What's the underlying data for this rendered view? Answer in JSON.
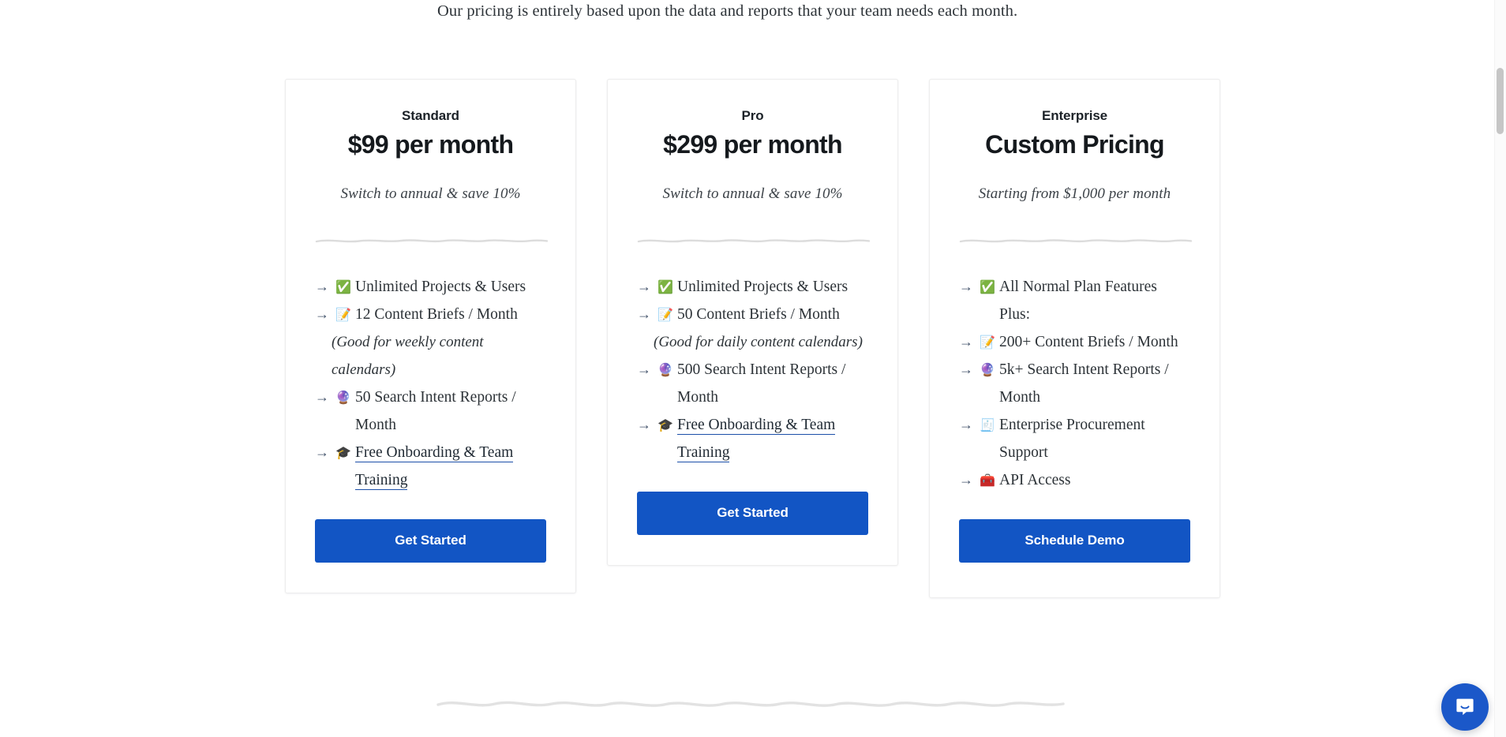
{
  "intro": {
    "paragraph": "Our pricing is entirely based upon the data and reports that your team needs each month."
  },
  "colors": {
    "cta_blue": "#1255c4",
    "link_underline": "#1b4fa8",
    "arrow": "#43536b",
    "divider": "#dcdcdc",
    "intercom_blue": "#1b58c9"
  },
  "plans": [
    {
      "name": "Standard",
      "price": "$99 per month",
      "note": "Switch to annual & save 10%",
      "features": [
        {
          "icon": "white-check-mark-icon",
          "emoji": "✅",
          "text": "Unlimited Projects & Users",
          "link": false
        },
        {
          "icon": "memo-icon",
          "emoji": "📝",
          "text": "12 Content Briefs / Month",
          "link": false
        },
        {
          "icon": "none",
          "emoji": "",
          "text": "(Good for weekly content calendars)",
          "sub": true
        },
        {
          "icon": "crystal-ball-icon",
          "emoji": "🔮",
          "text": "50 Search Intent Reports / Month",
          "link": false
        },
        {
          "icon": "graduation-cap-icon",
          "emoji": "🎓",
          "text": "Free Onboarding & Team Training",
          "link": true
        }
      ],
      "cta": "Get Started"
    },
    {
      "name": "Pro",
      "price": "$299 per month",
      "note": "Switch to annual & save 10%",
      "features": [
        {
          "icon": "white-check-mark-icon",
          "emoji": "✅",
          "text": "Unlimited Projects & Users",
          "link": false
        },
        {
          "icon": "memo-icon",
          "emoji": "📝",
          "text": "50 Content Briefs / Month",
          "link": false
        },
        {
          "icon": "none",
          "emoji": "",
          "text": "(Good for daily content calendars)",
          "sub": true
        },
        {
          "icon": "crystal-ball-icon",
          "emoji": "🔮",
          "text": "500 Search Intent Reports / Month",
          "link": false
        },
        {
          "icon": "graduation-cap-icon",
          "emoji": "🎓",
          "text": "Free Onboarding & Team Training",
          "link": true
        }
      ],
      "cta": "Get Started"
    },
    {
      "name": "Enterprise",
      "price": "Custom Pricing",
      "note": "Starting from $1,000 per month",
      "features": [
        {
          "icon": "white-check-mark-icon",
          "emoji": "✅",
          "text": "All Normal Plan Features Plus:",
          "link": false
        },
        {
          "icon": "memo-icon",
          "emoji": "📝",
          "text": "200+ Content Briefs / Month",
          "link": false
        },
        {
          "icon": "crystal-ball-icon",
          "emoji": "🔮",
          "text": "5k+ Search Intent Reports / Month",
          "link": false
        },
        {
          "icon": "receipt-icon",
          "emoji": "🧾",
          "text": "Enterprise Procurement Support",
          "link": false
        },
        {
          "icon": "toolbox-icon",
          "emoji": "🧰",
          "text": "API Access",
          "link": false
        }
      ],
      "cta": "Schedule Demo"
    }
  ],
  "chat": {
    "launcher_label": "Open Intercom Messenger"
  }
}
